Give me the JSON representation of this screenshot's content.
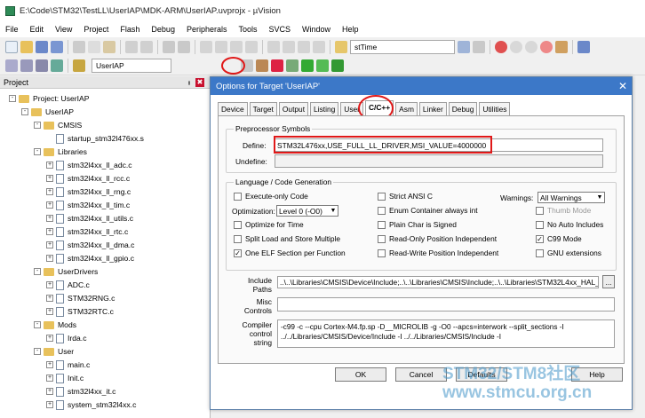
{
  "window": {
    "title": "E:\\Code\\STM32\\TestLL\\UserIAP\\MDK-ARM\\UserIAP.uvprojx - µVision"
  },
  "menu": [
    "File",
    "Edit",
    "View",
    "Project",
    "Flash",
    "Debug",
    "Peripherals",
    "Tools",
    "SVCS",
    "Window",
    "Help"
  ],
  "toolbar": {
    "find_combo": "stTime",
    "target_name": "UserIAP"
  },
  "project": {
    "title": "Project",
    "pin": "ᵻ",
    "close": "✖"
  },
  "tree": [
    {
      "label": "Project: UserIAP",
      "level": 0,
      "kind": "root",
      "exp": "-"
    },
    {
      "label": "UserIAP",
      "level": 1,
      "kind": "folder",
      "exp": "-"
    },
    {
      "label": "CMSIS",
      "level": 2,
      "kind": "folder",
      "exp": "-"
    },
    {
      "label": "startup_stm32l476xx.s",
      "level": 3,
      "kind": "file",
      "exp": ""
    },
    {
      "label": "Libraries",
      "level": 2,
      "kind": "folder",
      "exp": "-"
    },
    {
      "label": "stm32l4xx_ll_adc.c",
      "level": 3,
      "kind": "file",
      "exp": "+"
    },
    {
      "label": "stm32l4xx_ll_rcc.c",
      "level": 3,
      "kind": "file",
      "exp": "+"
    },
    {
      "label": "stm32l4xx_ll_rng.c",
      "level": 3,
      "kind": "file",
      "exp": "+"
    },
    {
      "label": "stm32l4xx_ll_tim.c",
      "level": 3,
      "kind": "file",
      "exp": "+"
    },
    {
      "label": "stm32l4xx_ll_utils.c",
      "level": 3,
      "kind": "file",
      "exp": "+"
    },
    {
      "label": "stm32l4xx_ll_rtc.c",
      "level": 3,
      "kind": "file",
      "exp": "+"
    },
    {
      "label": "stm32l4xx_ll_dma.c",
      "level": 3,
      "kind": "file",
      "exp": "+"
    },
    {
      "label": "stm32l4xx_ll_gpio.c",
      "level": 3,
      "kind": "file",
      "exp": "+"
    },
    {
      "label": "UserDrivers",
      "level": 2,
      "kind": "folder",
      "exp": "-"
    },
    {
      "label": "ADC.c",
      "level": 3,
      "kind": "file",
      "exp": "+"
    },
    {
      "label": "STM32RNG.c",
      "level": 3,
      "kind": "file",
      "exp": "+"
    },
    {
      "label": "STM32RTC.c",
      "level": 3,
      "kind": "file",
      "exp": "+"
    },
    {
      "label": "Mods",
      "level": 2,
      "kind": "folder",
      "exp": "-"
    },
    {
      "label": "Irda.c",
      "level": 3,
      "kind": "file",
      "exp": "+"
    },
    {
      "label": "User",
      "level": 2,
      "kind": "folder",
      "exp": "-"
    },
    {
      "label": "main.c",
      "level": 3,
      "kind": "file",
      "exp": "+"
    },
    {
      "label": "Init.c",
      "level": 3,
      "kind": "file",
      "exp": "+"
    },
    {
      "label": "stm32l4xx_it.c",
      "level": 3,
      "kind": "file",
      "exp": "+"
    },
    {
      "label": "system_stm32l4xx.c",
      "level": 3,
      "kind": "file",
      "exp": "+"
    }
  ],
  "dialog": {
    "title": "Options for Target 'UserIAP'",
    "tabs": [
      "Device",
      "Target",
      "Output",
      "Listing",
      "User",
      "C/C++",
      "Asm",
      "Linker",
      "Debug",
      "Utilities"
    ],
    "active_tab": "C/C++",
    "preproc": {
      "group": "Preprocessor Symbols",
      "define_label": "Define:",
      "define_value": "STM32L476xx,USE_FULL_LL_DRIVER,MSI_VALUE=4000000",
      "undefine_label": "Undefine:",
      "undefine_value": ""
    },
    "lang": {
      "group": "Language / Code Generation",
      "execute_only": "Execute-only Code",
      "optimization_label": "Optimization:",
      "optimization_value": "Level 0 (-O0)",
      "opt_time": "Optimize for Time",
      "split_load": "Split Load and Store Multiple",
      "one_elf": "One ELF Section per Function",
      "strict_ansi": "Strict ANSI C",
      "enum_container": "Enum Container always int",
      "plain_char": "Plain Char is Signed",
      "ro_pi": "Read-Only Position Independent",
      "rw_pi": "Read-Write Position Independent",
      "warnings_label": "Warnings:",
      "warnings_value": "All Warnings",
      "thumb_mode": "Thumb Mode",
      "no_auto": "No Auto Includes",
      "c99": "C99 Mode",
      "gnu": "GNU extensions"
    },
    "include_label_1": "Include",
    "include_label_2": "Paths",
    "include_value": "..\\..\\Libraries\\CMSIS\\Device\\Include;..\\..\\Libraries\\CMSIS\\Include;..\\..\\Libraries\\STM32L4xx_HAL_",
    "include_browse": "...",
    "misc_label_1": "Misc",
    "misc_label_2": "Controls",
    "misc_value": "",
    "compiler_label_1": "Compiler",
    "compiler_label_2": "control",
    "compiler_label_3": "string",
    "compiler_line_1": "-c99 -c --cpu Cortex-M4.fp.sp -D__MICROLIB -g -O0 --apcs=interwork --split_sections -I",
    "compiler_line_2": "../../Libraries/CMSIS/Device/Include -I ../../Libraries/CMSIS/Include -I",
    "buttons": {
      "ok": "OK",
      "cancel": "Cancel",
      "defaults": "Defaults",
      "help": "Help"
    }
  },
  "watermark": {
    "line1": "STM32/STM8社区",
    "line2": "www.stmcu.org.cn"
  }
}
